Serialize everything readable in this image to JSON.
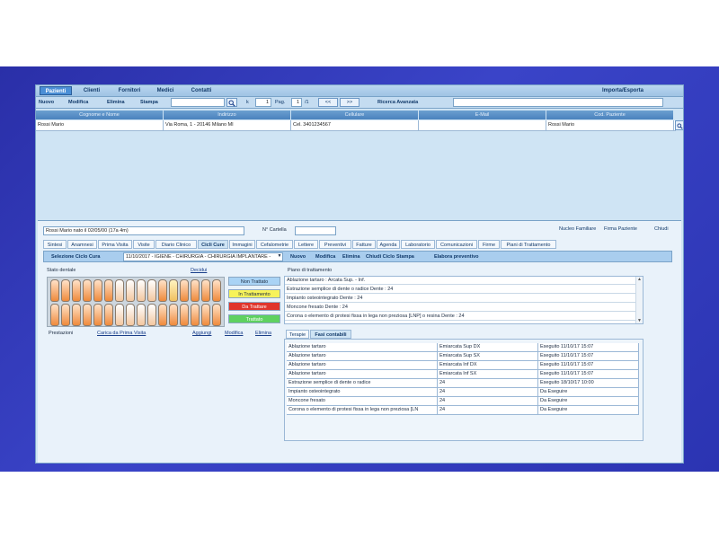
{
  "nav": {
    "tabs": [
      {
        "label": "Pazienti",
        "active": true
      },
      {
        "label": "Clienti"
      },
      {
        "label": "Fornitori"
      },
      {
        "label": "Medici"
      },
      {
        "label": "Contatti"
      }
    ],
    "import_export": "Importa/Esporta"
  },
  "toolbar": {
    "nuovo": "Nuovo",
    "modifica": "Modifica",
    "elimina": "Elimina",
    "stampa": "Stampa",
    "k_label": "k",
    "page_value": "1",
    "pag_label": "Pag.",
    "page_num": "1",
    "page_total": "/1",
    "prev": "<<",
    "next": ">>",
    "advanced_search": "Ricerca Avanzata"
  },
  "patients_table": {
    "headers": [
      "Cognome e Nome",
      "Indirizzo",
      "Cellulare",
      "E-Mail",
      "Cod. Paziente"
    ],
    "rows": [
      [
        "Rossi Mario",
        "Via Roma, 1 - 20146 Milano MI",
        "Cel. 3401234567",
        "",
        "Rossi Mario"
      ]
    ]
  },
  "patient": {
    "name_field": "Rossi Mario nato il 02/05/00 (17a 4m)",
    "cartella_label": "N° Cartella",
    "cartella_value": "",
    "links": [
      "Nucleo Familiare",
      "Firma Paziente",
      "Chiudi"
    ]
  },
  "detail_tabs": [
    {
      "label": "Sintesi"
    },
    {
      "label": "Anamnesi"
    },
    {
      "label": "Prima Visita"
    },
    {
      "label": "Visite"
    },
    {
      "label": "Diario Clinico"
    },
    {
      "label": "Cicli Cure",
      "active": true
    },
    {
      "label": "Immagini"
    },
    {
      "label": "Cefalometrie"
    },
    {
      "label": "Lettere"
    },
    {
      "label": "Preventivi"
    },
    {
      "label": "Fatture"
    },
    {
      "label": "Agenda"
    },
    {
      "label": "Laboratorio"
    },
    {
      "label": "Comunicazioni"
    },
    {
      "label": "Firme"
    },
    {
      "label": "Piani di Trattamento"
    }
  ],
  "cycle_bar": {
    "label": "Selezione Ciclo Cura",
    "selected": "11/10/2017 - IGIENE - CHIRURGIA - CHIRURGIA IMPLANTARE -",
    "buttons": [
      "Nuovo",
      "Modifica",
      "Elimina",
      "Chiudi Ciclo",
      "Stampa",
      "Elabora preventivo"
    ]
  },
  "odontogram": {
    "title": "Stato dentale",
    "decidui": "Decidui",
    "legend": [
      {
        "label": "Non Trattato",
        "color": "#a9d3f5"
      },
      {
        "label": "In Trattamento",
        "color": "#f7f35a"
      },
      {
        "label": "Da Trattare",
        "color": "#e0352b"
      },
      {
        "label": "Trattato",
        "color": "#5fd160"
      }
    ],
    "actions": [
      "Prestazioni",
      "Carica da Prima Visita",
      "Aggiungi",
      "Modifica",
      "Elimina"
    ]
  },
  "plan": {
    "title": "Piano di trattamento",
    "items": [
      "Ablazione tartaro : Arcata Sup. - Inf.",
      "Estrazione semplice di dente o radice  Dente : 24",
      "Impianto osteointegrato  Dente : 24",
      "Moncone fresato  Dente : 24",
      "Corona o elemento di protesi fissa in lega non preziosa [LNP] o resina  Dente : 24"
    ]
  },
  "detail_sub_tabs": [
    {
      "label": "Terapie"
    },
    {
      "label": "Fasi contabili",
      "active": true
    }
  ],
  "phases": {
    "rows": [
      [
        "Ablazione tartaro",
        "Emiarcata Sup DX",
        "Eseguito 11/10/17 15:07"
      ],
      [
        "Ablazione tartaro",
        "Emiarcata Sup SX",
        "Eseguito 11/10/17 15:07"
      ],
      [
        "Ablazione tartaro",
        "Emiarcata Inf DX",
        "Eseguito 11/10/17 15:07"
      ],
      [
        "Ablazione tartaro",
        "Emiarcata Inf SX",
        "Eseguito 11/10/17 15:07"
      ],
      [
        "Estrazione semplice di dente o radice",
        "24",
        "Eseguito 18/10/17 10:00"
      ],
      [
        "Impianto osteointegrato",
        "24",
        "Da Eseguire"
      ],
      [
        "Moncone fresato",
        "24",
        "Da Eseguire"
      ],
      [
        "Corona o elemento di protesi fissa in lega non preziosa [LN",
        "24",
        "Da Eseguire"
      ]
    ]
  }
}
